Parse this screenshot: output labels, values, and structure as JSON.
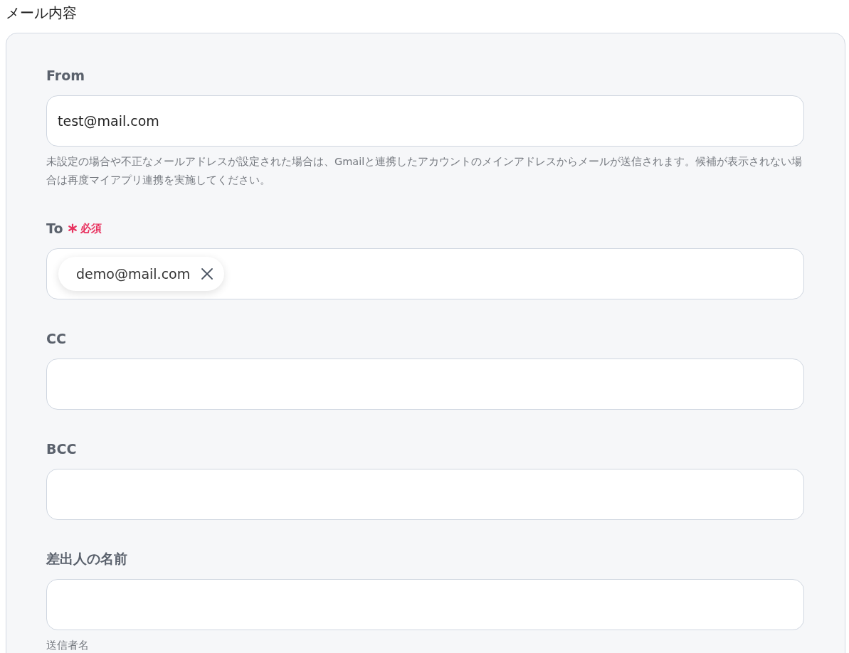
{
  "section_title": "メール内容",
  "fields": [
    {
      "kind": "text",
      "label": "From",
      "value": "test@mail.com",
      "help": "未設定の場合や不正なメールアドレスが設定された場合は、Gmailと連携したアカウントのメインアドレスからメールが送信されます。候補が表示されない場合は再度マイアプリ連携を実施してください。"
    },
    {
      "kind": "chips",
      "label": "To",
      "required_label": "必須",
      "chips": [
        "demo@mail.com"
      ]
    },
    {
      "kind": "chips",
      "label": "CC"
    },
    {
      "kind": "chips",
      "label": "BCC"
    },
    {
      "kind": "text",
      "label": "差出人の名前",
      "help": "送信者名"
    }
  ]
}
